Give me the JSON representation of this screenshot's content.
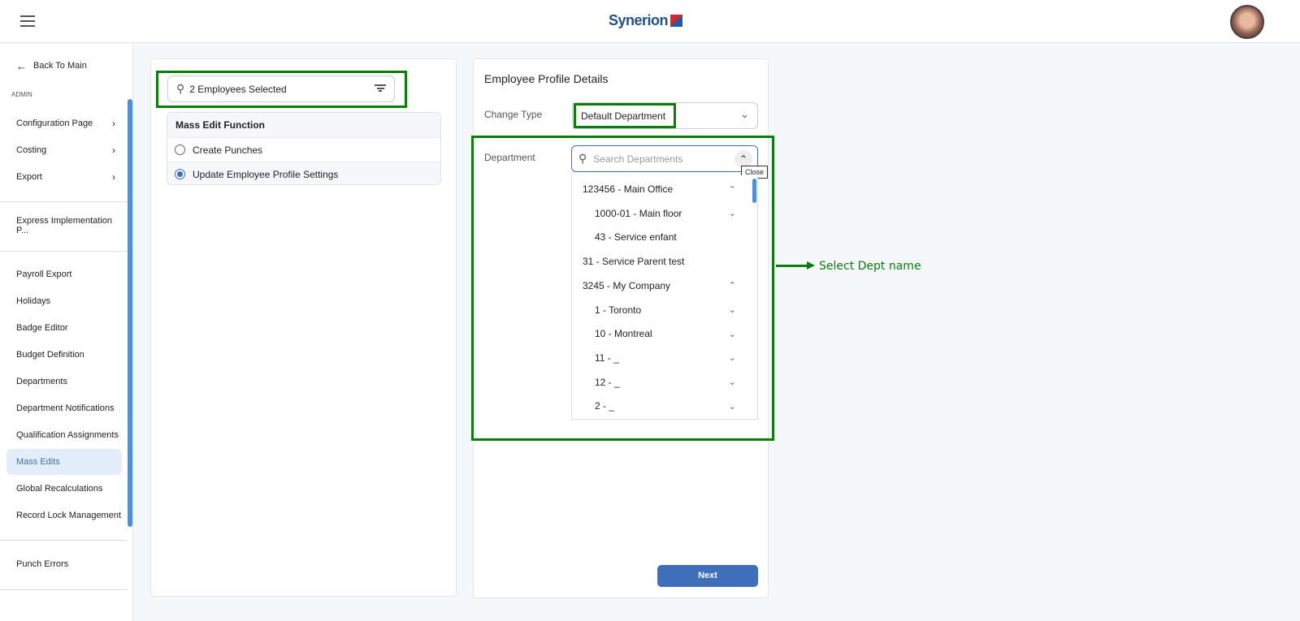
{
  "header": {
    "brand": "Synerion",
    "menu_icon": "hamburger-icon",
    "avatar": "user-avatar"
  },
  "sidebar": {
    "back": "Back To Main",
    "section": "ADMIN",
    "group1": [
      {
        "label": "Configuration Page",
        "chev": true
      },
      {
        "label": "Costing",
        "chev": true
      },
      {
        "label": "Export",
        "chev": true
      }
    ],
    "group2": [
      {
        "label": "Express Implementation P..."
      }
    ],
    "group3": [
      {
        "label": "Payroll Export"
      },
      {
        "label": "Holidays"
      },
      {
        "label": "Badge Editor"
      },
      {
        "label": "Budget Definition"
      },
      {
        "label": "Departments"
      },
      {
        "label": "Department Notifications"
      },
      {
        "label": "Qualification Assignments"
      },
      {
        "label": "Mass Edits",
        "selected": true
      },
      {
        "label": "Global Recalculations"
      },
      {
        "label": "Record Lock Management"
      }
    ],
    "group4": [
      {
        "label": "Punch Errors"
      }
    ]
  },
  "left": {
    "employees": "2 Employees Selected",
    "function_title": "Mass Edit Function",
    "options": [
      {
        "label": "Create Punches",
        "checked": false
      },
      {
        "label": "Update Employee Profile Settings",
        "checked": true
      }
    ]
  },
  "right": {
    "title": "Employee Profile Details",
    "change_type_label": "Change Type",
    "change_type_value": "Default Department",
    "department_label": "Department",
    "search_placeholder": "Search Departments",
    "tooltip": "Close",
    "next": "Next",
    "departments": [
      {
        "label": "123456 - Main Office",
        "level": 0,
        "icon": "up"
      },
      {
        "label": "1000-01 - Main floor",
        "level": 1,
        "icon": "down"
      },
      {
        "label": "43 - Service enfant",
        "level": 1,
        "icon": ""
      },
      {
        "label": "31 - Service Parent test",
        "level": 0,
        "icon": ""
      },
      {
        "label": "3245 - My Company",
        "level": 0,
        "icon": "up"
      },
      {
        "label": "1 - Toronto",
        "level": 1,
        "icon": "down"
      },
      {
        "label": "10 - Montreal",
        "level": 1,
        "icon": "down"
      },
      {
        "label": "11 - _",
        "level": 1,
        "icon": "down"
      },
      {
        "label": "12 - _",
        "level": 1,
        "icon": "down"
      },
      {
        "label": "2 - _",
        "level": 1,
        "icon": "down"
      }
    ]
  },
  "annotation": {
    "text": "Select Dept name",
    "color": "#0b7d0b"
  },
  "colors": {
    "accent": "#3f6fba",
    "highlight": "#0b7d0b"
  }
}
